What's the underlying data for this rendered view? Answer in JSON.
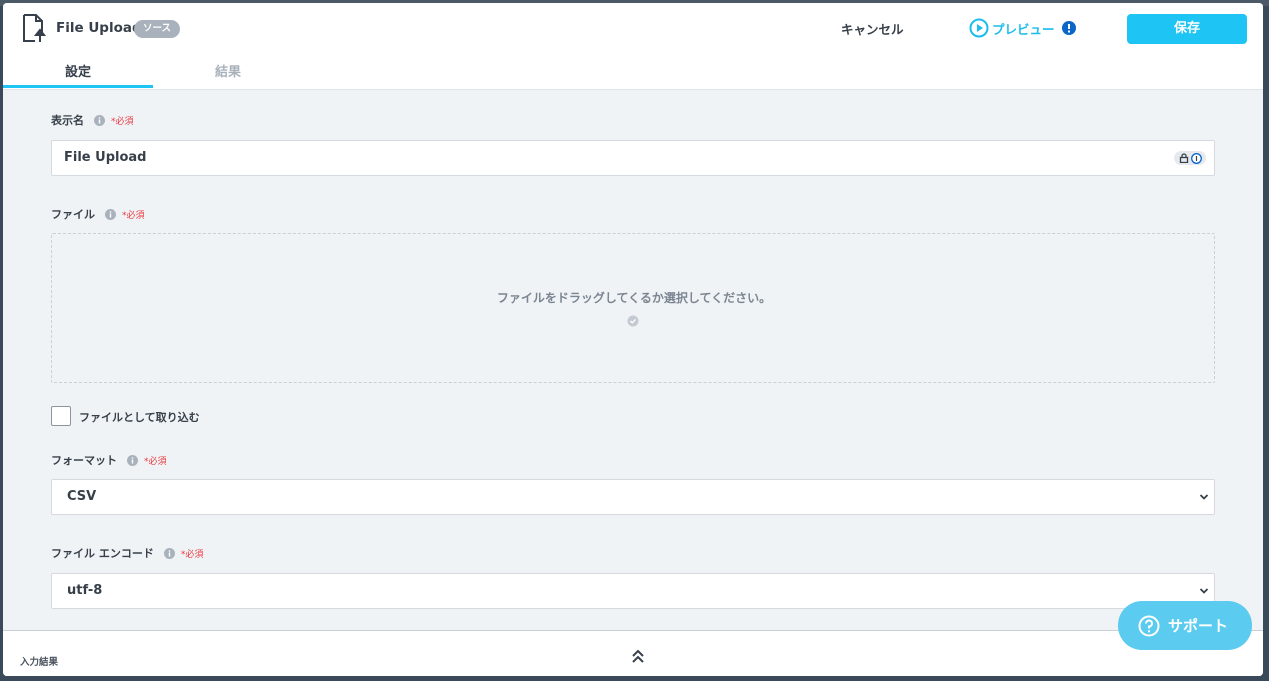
{
  "header": {
    "title": "File Upload",
    "badge": "ソース",
    "cancel_label": "キャンセル",
    "preview_label": "プレビュー",
    "save_label": "保存"
  },
  "tabs": [
    {
      "label": "設定",
      "active": true
    },
    {
      "label": "結果",
      "active": false
    }
  ],
  "form": {
    "display_name": {
      "label": "表示名",
      "required": "*必須",
      "value": "File Upload"
    },
    "file": {
      "label": "ファイル",
      "required": "*必須",
      "dropzone_text": "ファイルをドラッグしてくるか選択してください。"
    },
    "import_as_file": {
      "label": "ファイルとして取り込む",
      "checked": false
    },
    "format": {
      "label": "フォーマット",
      "required": "*必須",
      "value": "CSV"
    },
    "encoding": {
      "label": "ファイル エンコード",
      "required": "*必須",
      "value": "utf-8"
    }
  },
  "footer": {
    "label": "入力結果"
  },
  "support": {
    "label": "サポート"
  },
  "colors": {
    "accent": "#1ec4f3",
    "required": "#e8383d",
    "support": "#5bcbef"
  },
  "icons": [
    "file-upload-icon",
    "play-circle-icon",
    "alert-circle-icon",
    "info-icon",
    "lock-icon",
    "check-circle-icon",
    "chevron-down-icon",
    "double-chevron-up-icon",
    "help-circle-icon"
  ]
}
